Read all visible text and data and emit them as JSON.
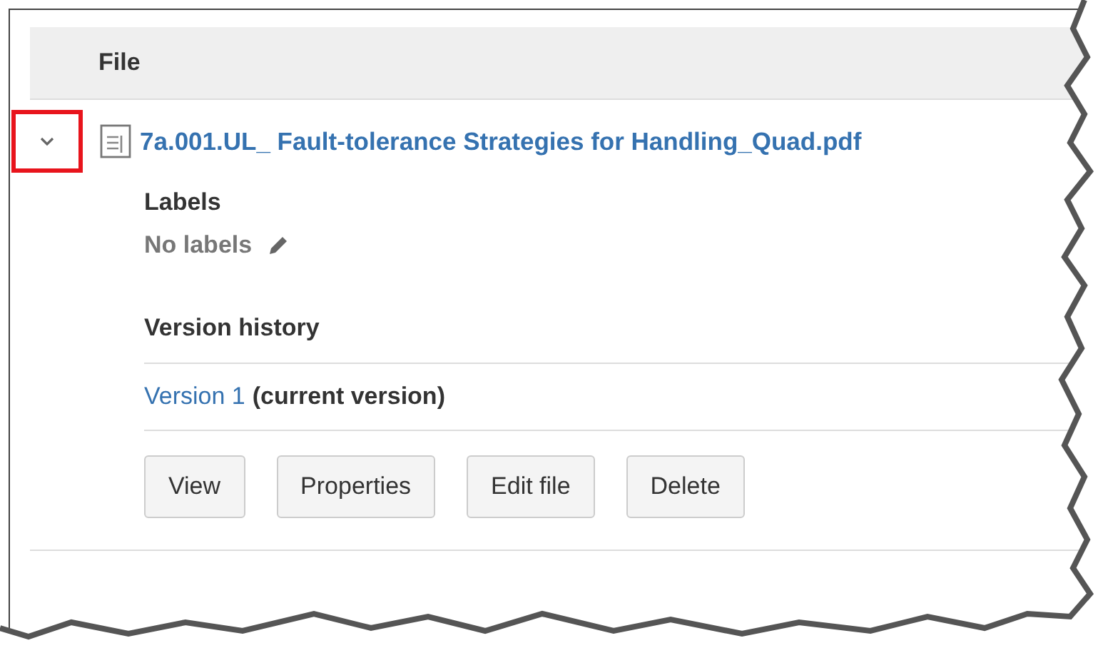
{
  "table": {
    "columns": [
      "File"
    ],
    "rows": [
      {
        "expanded": true,
        "toggle_highlighted": true,
        "name": "7a.001.UL_ Fault-tolerance Strategies for Handling_Quad.pdf",
        "details": {
          "labels_heading": "Labels",
          "labels_value": "No labels",
          "version_history_heading": "Version history",
          "versions": [
            {
              "link": "Version 1",
              "note": "(current version)"
            }
          ],
          "actions": [
            "View",
            "Properties",
            "Edit file",
            "Delete"
          ]
        }
      }
    ]
  }
}
